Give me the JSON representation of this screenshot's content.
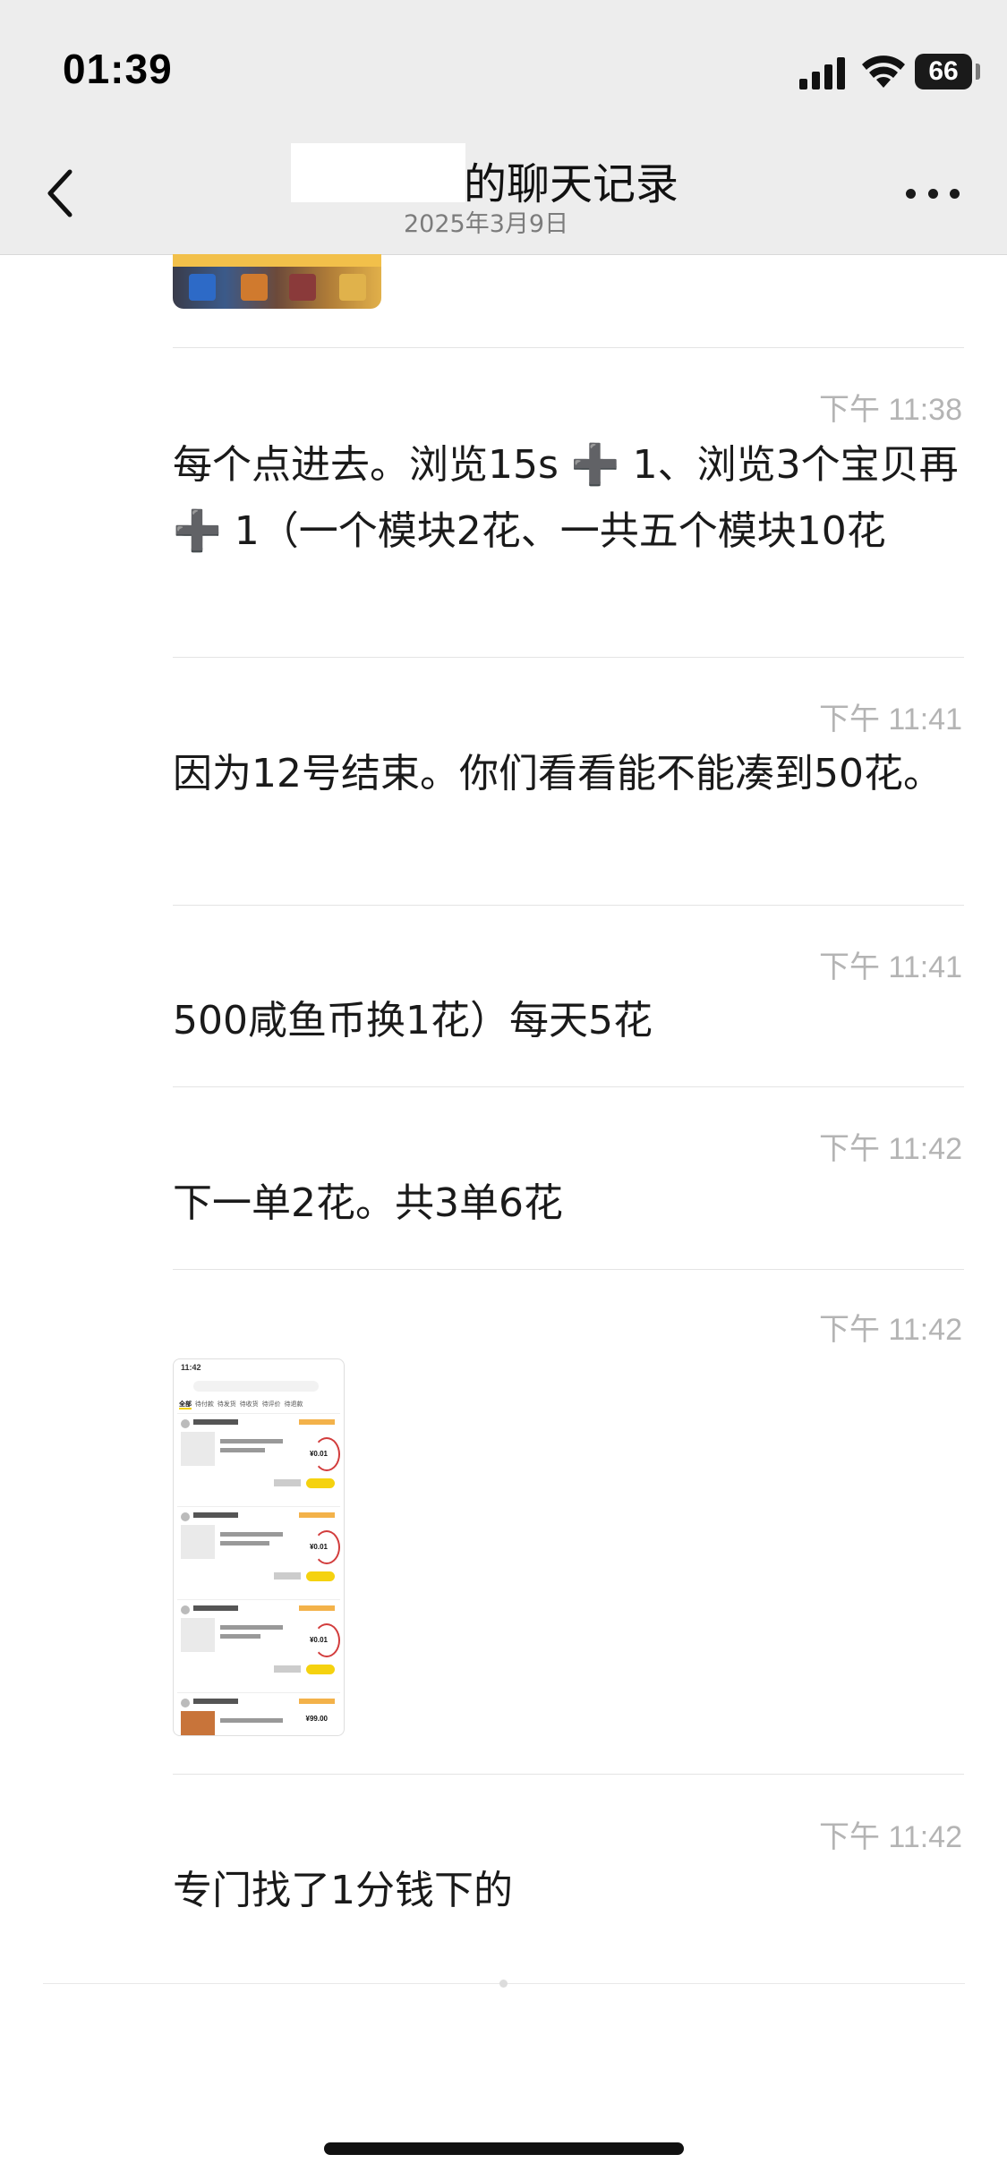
{
  "status_bar": {
    "time": "01:39",
    "battery": "66"
  },
  "header": {
    "title": "的聊天记录",
    "subtitle": "2025年3月9日",
    "back_icon": "chevron-left-icon",
    "more_icon": "more-dots-icon"
  },
  "messages": [
    {
      "time": "下午 11:38",
      "text": "每个点进去。浏览15s ➕ 1、浏览3个宝贝再 ➕ 1（一个模块2花、一共五个模块10花"
    },
    {
      "time": "下午 11:41",
      "text": "因为12号结束。你们看看能不能凑到50花。"
    },
    {
      "time": "下午 11:41",
      "text": "500咸鱼币换1花）每天5花"
    },
    {
      "time": "下午 11:42",
      "text": "下一单2花。共3单6花"
    },
    {
      "time": "下午 11:42",
      "type": "image"
    },
    {
      "time": "下午 11:42",
      "text": "专门找了1分钱下的"
    }
  ],
  "screenshot": {
    "status_time": "11:42",
    "tabs": [
      "全部",
      "待付款",
      "待发货",
      "待收货",
      "待评价",
      "待退款"
    ],
    "prices": [
      "¥0.01",
      "¥0.01",
      "¥0.01",
      "¥99.00"
    ]
  },
  "colors": {
    "header_bg": "#ededed",
    "timestamp": "#b4b4b4",
    "divider": "#e4e4e4"
  }
}
